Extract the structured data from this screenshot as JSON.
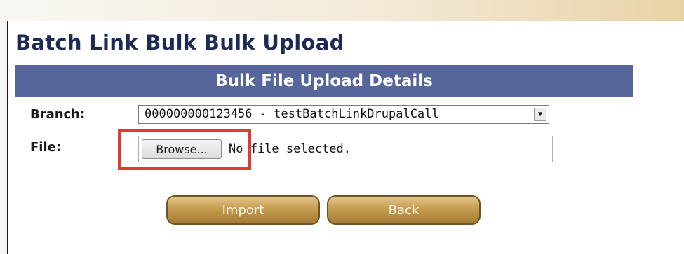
{
  "page": {
    "title": "Batch Link Bulk Bulk Upload"
  },
  "section": {
    "header": "Bulk File Upload Details"
  },
  "form": {
    "branch_label": "Branch:",
    "branch_value": "000000000123456 - testBatchLinkDrupalCall",
    "file_label": "File:",
    "browse_label": "Browse...",
    "file_status": "No file selected."
  },
  "actions": {
    "import_label": "Import",
    "back_label": "Back"
  },
  "colors": {
    "header_bg": "#56669b",
    "title_text": "#1d2a55",
    "button_gold": "#c59c50",
    "highlight_red": "#e03a34"
  },
  "icons": {
    "select_arrow": "chevron-down-icon"
  }
}
